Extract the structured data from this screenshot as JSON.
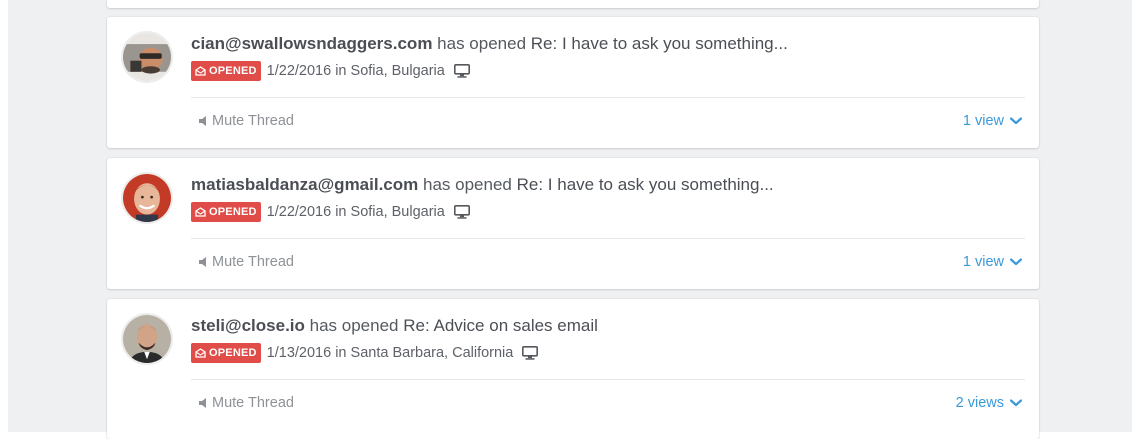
{
  "activity": [
    {
      "email": "cian@swallowsndaggers.com",
      "action": "has opened",
      "subject": "Re: I have to ask you something...",
      "badge": "OPENED",
      "date": "1/22/2016",
      "in_word": "in",
      "location": "Sofia, Bulgaria",
      "device_icon": "desktop-icon",
      "mute_label": "Mute Thread",
      "views_label": "1 view",
      "avatar_palette": [
        "#9b9590",
        "#2d2a28",
        "#c98d6a"
      ]
    },
    {
      "email": "matiasbaldanza@gmail.com",
      "action": "has opened",
      "subject": "Re: I have to ask you something...",
      "badge": "OPENED",
      "date": "1/22/2016",
      "in_word": "in",
      "location": "Sofia, Bulgaria",
      "device_icon": "desktop-icon",
      "mute_label": "Mute Thread",
      "views_label": "1 view",
      "avatar_palette": [
        "#c33a26",
        "#e8b79a",
        "#7a4a2a"
      ]
    },
    {
      "email": "steli@close.io",
      "action": "has opened",
      "subject": "Re: Advice on sales email",
      "badge": "OPENED",
      "date": "1/13/2016",
      "in_word": "in",
      "location": "Santa Barbara, California",
      "device_icon": "desktop-icon",
      "mute_label": "Mute Thread",
      "views_label": "2 views",
      "avatar_palette": [
        "#b7b0a4",
        "#2b2b2d",
        "#d1a488"
      ]
    }
  ],
  "colors": {
    "badge_bg": "#e04d48",
    "link": "#3a9ad9",
    "background": "#eff0f2",
    "muted_text": "#8e9297"
  }
}
